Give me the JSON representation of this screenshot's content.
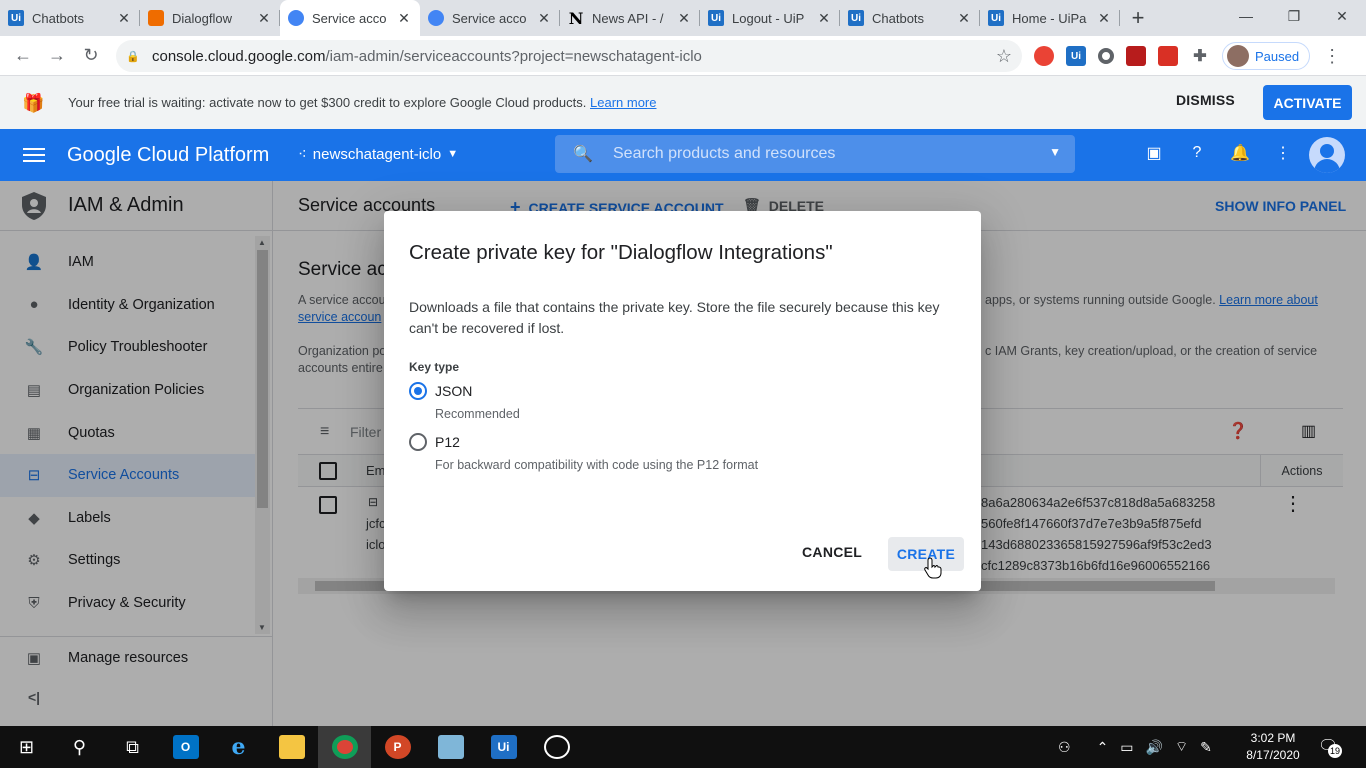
{
  "browser": {
    "tabs": [
      {
        "title": "Chatbots",
        "icon": "uipath-icon"
      },
      {
        "title": "Dialogflow",
        "icon": "dialogflow-icon"
      },
      {
        "title": "Service acco",
        "icon": "gcp-shield-icon",
        "active": true
      },
      {
        "title": "Service acco",
        "icon": "gcp-shield-icon"
      },
      {
        "title": "News API - /",
        "icon": "newsapi-icon"
      },
      {
        "title": "Logout - UiP",
        "icon": "uipath-icon"
      },
      {
        "title": "Chatbots",
        "icon": "uipath-icon"
      },
      {
        "title": "Home - UiPa",
        "icon": "uipath-icon"
      }
    ],
    "url_host": "console.cloud.google.com",
    "url_path": "/iam-admin/serviceaccounts?project=newschatagent-iclo",
    "profile_label": "Paused"
  },
  "banner": {
    "message": "Your free trial is waiting: activate now to get $300 credit to explore Google Cloud products.",
    "learn_more": "Learn more",
    "dismiss": "DISMISS",
    "activate": "ACTIVATE"
  },
  "gcp": {
    "brand": "Google Cloud Platform",
    "project": "newschatagent-iclo",
    "search_placeholder": "Search products and resources"
  },
  "sidebar": {
    "title": "IAM & Admin",
    "items": [
      {
        "label": "IAM",
        "icon": "person-add-icon"
      },
      {
        "label": "Identity & Organization",
        "icon": "account-circle-icon"
      },
      {
        "label": "Policy Troubleshooter",
        "icon": "wrench-icon"
      },
      {
        "label": "Organization Policies",
        "icon": "list-doc-icon"
      },
      {
        "label": "Quotas",
        "icon": "quota-icon"
      },
      {
        "label": "Service Accounts",
        "icon": "service-account-icon",
        "selected": true
      },
      {
        "label": "Labels",
        "icon": "label-icon"
      },
      {
        "label": "Settings",
        "icon": "gear-icon"
      },
      {
        "label": "Privacy & Security",
        "icon": "shield-icon"
      }
    ],
    "manage_resources": "Manage resources"
  },
  "page": {
    "title": "Service accounts",
    "create_button": "CREATE SERVICE ACCOUNT",
    "delete_button": "DELETE",
    "info_panel": "SHOW INFO PANEL",
    "section_title": "Service ac",
    "desc1_left": "A service accou",
    "desc1_left_link": "service accoun",
    "desc1_right": "apps, or systems running outside Google.",
    "desc1_right_link": "Learn more about",
    "desc2_left_a": "Organization po",
    "desc2_left_b": "accounts entire",
    "desc2_right_a": "c IAM Grants, key creation/upload, or the creation of service",
    "filter_label": "Filter",
    "col_email": "Em",
    "col_actions": "Actions",
    "row_left": [
      "jcfc",
      "iclo"
    ],
    "row_hash": [
      "8a6a280634a2e6f537c818d8a5a683258",
      "560fe8f147660f37d7e7e3b9a5f875efd",
      "143d688023365815927596af9f53c2ed3",
      "cfc1289c8373b16b6fd16e96006552166"
    ]
  },
  "dialog": {
    "title": "Create private key for \"Dialogflow Integrations\"",
    "body": "Downloads a file that contains the private key. Store the file securely because this key can't be recovered if lost.",
    "key_type_label": "Key type",
    "options": [
      {
        "label": "JSON",
        "sub": "Recommended",
        "selected": true
      },
      {
        "label": "P12",
        "sub": "For backward compatibility with code using the P12 format",
        "selected": false
      }
    ],
    "cancel": "CANCEL",
    "create": "CREATE"
  },
  "taskbar": {
    "time": "3:02 PM",
    "date": "8/17/2020",
    "notifications": "19"
  }
}
